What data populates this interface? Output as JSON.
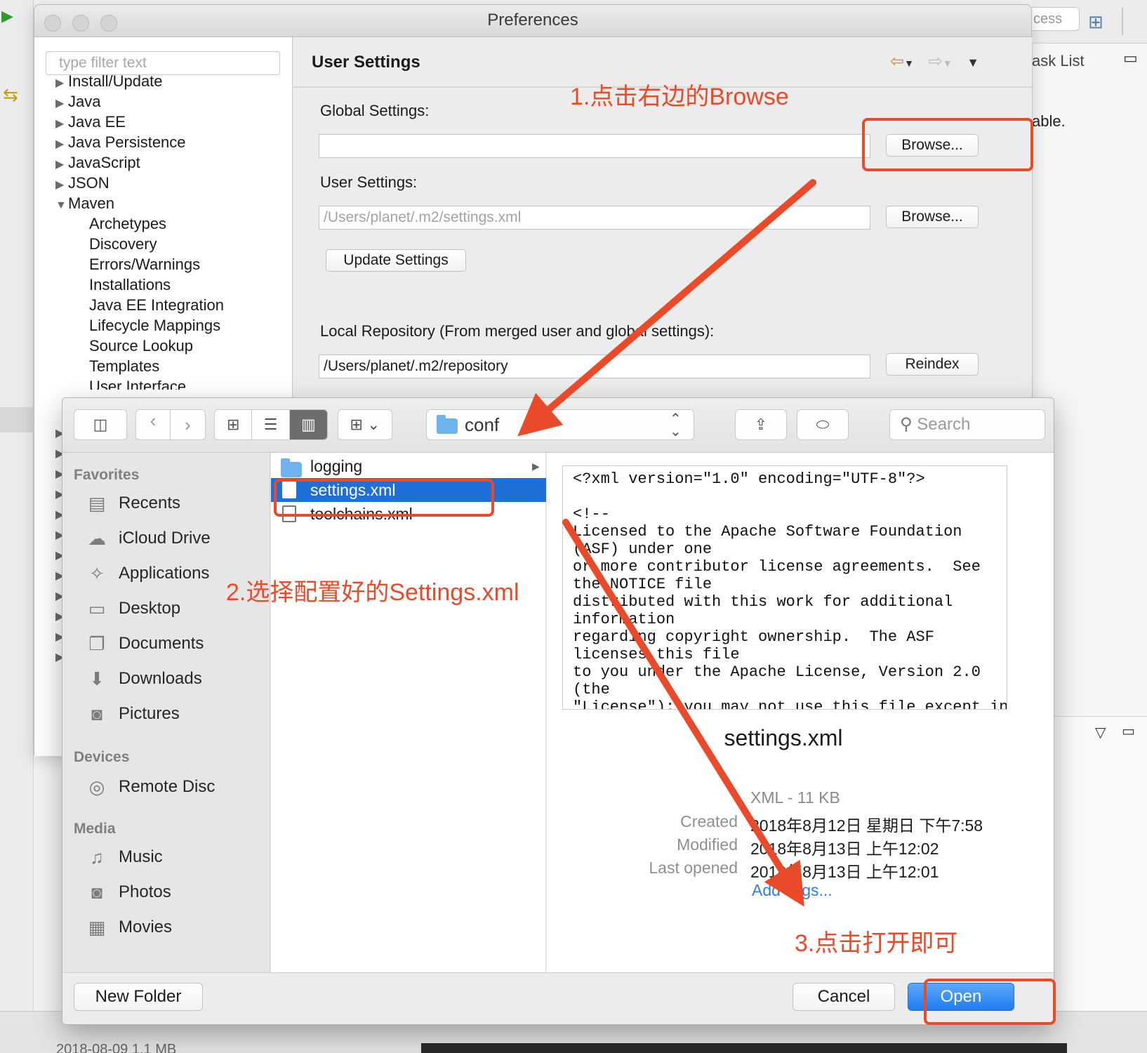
{
  "background": {
    "access_text": "cess",
    "task_list": "ask List",
    "able_text": "able.",
    "bottom_text": "2018-08-09      1.1 MB"
  },
  "preferences": {
    "window_title": "Preferences",
    "filter_placeholder": "type filter text",
    "tree": [
      {
        "label": "Install/Update",
        "expanded": false
      },
      {
        "label": "Java",
        "expanded": false
      },
      {
        "label": "Java EE",
        "expanded": false
      },
      {
        "label": "Java Persistence",
        "expanded": false
      },
      {
        "label": "JavaScript",
        "expanded": false
      },
      {
        "label": "JSON",
        "expanded": false
      },
      {
        "label": "Maven",
        "expanded": true
      }
    ],
    "maven_children": [
      "Archetypes",
      "Discovery",
      "Errors/Warnings",
      "Installations",
      "Java EE Integration",
      "Lifecycle Mappings",
      "Source Lookup",
      "Templates",
      "User Interface"
    ],
    "page_title": "User Settings",
    "global_settings_label": "Global Settings:",
    "global_settings_value": "",
    "browse_label": "Browse...",
    "user_settings_label": "User Settings:",
    "user_settings_value": "/Users/planet/.m2/settings.xml",
    "update_settings_label": "Update Settings",
    "local_repo_label": "Local Repository (From merged user and global settings):",
    "local_repo_value": "/Users/planet/.m2/repository",
    "reindex_label": "Reindex"
  },
  "dialog": {
    "path_folder": "conf",
    "search_placeholder": "Search",
    "favorites_header": "Favorites",
    "favorites": [
      {
        "label": "Recents",
        "icon": "recents-icon"
      },
      {
        "label": "iCloud Drive",
        "icon": "cloud-icon"
      },
      {
        "label": "Applications",
        "icon": "applications-icon"
      },
      {
        "label": "Desktop",
        "icon": "desktop-icon"
      },
      {
        "label": "Documents",
        "icon": "documents-icon"
      },
      {
        "label": "Downloads",
        "icon": "downloads-icon"
      },
      {
        "label": "Pictures",
        "icon": "camera-icon"
      }
    ],
    "devices_header": "Devices",
    "devices": [
      {
        "label": "Remote Disc",
        "icon": "disc-icon"
      }
    ],
    "media_header": "Media",
    "media": [
      {
        "label": "Music",
        "icon": "music-icon"
      },
      {
        "label": "Photos",
        "icon": "camera-icon"
      },
      {
        "label": "Movies",
        "icon": "film-icon"
      }
    ],
    "files": [
      {
        "name": "logging",
        "kind": "folder",
        "selected": false
      },
      {
        "name": "settings.xml",
        "kind": "file",
        "selected": true
      },
      {
        "name": "toolchains.xml",
        "kind": "file",
        "selected": false
      }
    ],
    "preview_lines": [
      "<?xml version=\"1.0\" encoding=\"UTF-8\"?>",
      "",
      "<!--",
      "Licensed to the Apache Software Foundation",
      "(ASF) under one",
      "or more contributor license agreements.  See",
      "the NOTICE file",
      "distributed with this work for additional",
      "information",
      "regarding copyright ownership.  The ASF",
      "licenses this file",
      "to you under the Apache License, Version 2.0",
      "(the",
      "\"License\"); you may not use this file except in"
    ],
    "preview_name": "settings.xml",
    "preview_kind": "XML - 11 KB",
    "meta": [
      {
        "key": "Created",
        "value": "2018年8月12日 星期日 下午7:58"
      },
      {
        "key": "Modified",
        "value": "2018年8月13日 上午12:02"
      },
      {
        "key": "Last opened",
        "value": "2018年8月13日 上午12:01"
      }
    ],
    "add_tags": "Add Tags...",
    "new_folder_label": "New Folder",
    "cancel_label": "Cancel",
    "open_label": "Open"
  },
  "annotations": {
    "step1": "1.点击右边的Browse",
    "step2": "2.选择配置好的Settings.xml",
    "step3": "3.点击打开即可",
    "color": "#e94a2a"
  }
}
